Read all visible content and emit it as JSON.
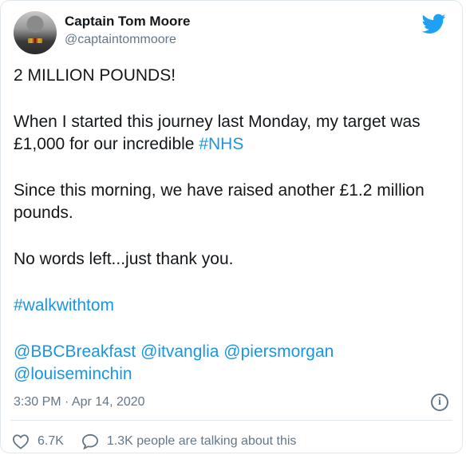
{
  "user": {
    "name": "Captain Tom Moore",
    "handle": "@captaintommoore"
  },
  "tweet": {
    "line1": "2 MILLION POUNDS!",
    "line2_text": "When I started this journey last Monday, my target was £1,000 for our incredible ",
    "line2_hashtag": "#NHS",
    "line3": "Since this morning, we have raised another £1.2 million pounds.",
    "line4": "No words left...just thank you.",
    "hashtag_walk": "#walkwithtom",
    "mentions": [
      "@BBCBreakfast",
      "@itvanglia",
      "@piersmorgan",
      "@louiseminchin"
    ]
  },
  "meta": {
    "timestamp": "3:30 PM · Apr 14, 2020"
  },
  "actions": {
    "likes": "6.7K",
    "replies_text": "1.3K people are talking about this"
  },
  "icons": {
    "logo": "twitter-bird-icon",
    "info": "info-icon",
    "like": "heart-icon",
    "reply": "speech-bubble-icon"
  },
  "colors": {
    "link": "#1b95e0",
    "brand": "#1da1f2",
    "secondary_text": "#657786"
  }
}
